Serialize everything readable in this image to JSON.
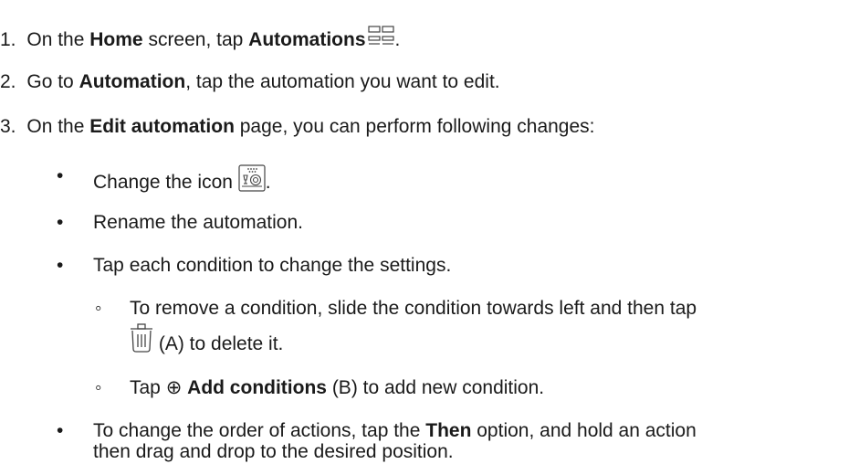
{
  "steps": [
    {
      "number": "1.",
      "prefix": "On the ",
      "bold1": "Home",
      "middle": " screen, tap ",
      "bold2": "Automations",
      "icon": "automations-grid-icon",
      "suffix": "."
    },
    {
      "number": "2.",
      "prefix": "Go to ",
      "bold1": "Automation",
      "suffix": ", tap the automation you want to edit."
    },
    {
      "number": "3.",
      "prefix": "On the ",
      "bold1": "Edit automation",
      "suffix": " page, you can perform following changes:"
    }
  ],
  "bullets": [
    {
      "marker": "•",
      "text": "Change the icon ",
      "icon": "dishwasher-icon",
      "suffix": "."
    },
    {
      "marker": "•",
      "text": "Rename the automation."
    },
    {
      "marker": "•",
      "text": "Tap each condition to change the settings."
    },
    {
      "marker": "•",
      "line1_prefix": "To change the order of actions, tap the ",
      "bold": "Then",
      "line1_suffix": " option, and hold an action",
      "line2": "then drag and drop to the desired position."
    }
  ],
  "sub_bullets": [
    {
      "marker": "◦",
      "line1": "To remove a condition, slide the condition towards left and then tap",
      "icon": "trash-icon",
      "line2": " (A) to delete it."
    },
    {
      "marker": "◦",
      "prefix": "Tap ",
      "symbol": "⊕",
      "bold": "Add conditions",
      "suffix": " (B) to add new condition."
    }
  ]
}
